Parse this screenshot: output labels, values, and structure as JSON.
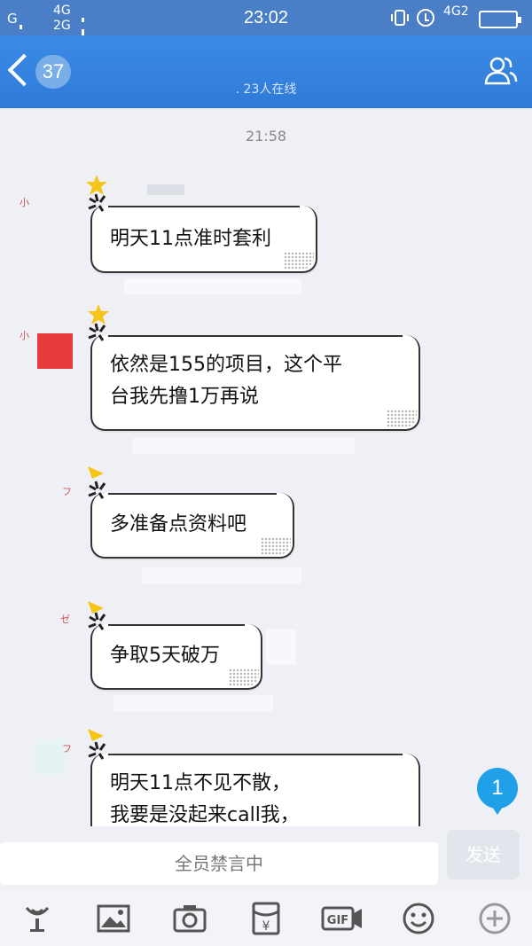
{
  "status_bar": {
    "left_signal_1": "G",
    "net_1": "4G",
    "net_2": "2G",
    "time": "23:02",
    "right_net": "4G2"
  },
  "header": {
    "back_count": "37",
    "subtitle": ". 23人在线"
  },
  "chat": {
    "timestamp": "21:58",
    "messages": [
      {
        "name_tag": "小",
        "lines": [
          "明天11点准时套利"
        ]
      },
      {
        "name_tag": "小",
        "lines": [
          "依然是155的项目，这个平",
          "台我先撸1万再说"
        ]
      },
      {
        "name_tag": "フ",
        "lines": [
          "多准备点资料吧"
        ]
      },
      {
        "name_tag": "ゼ",
        "lines": [
          "争取5天破万"
        ]
      },
      {
        "name_tag": "フ",
        "lines": [
          "明天11点不见不散，",
          "我要是没起来call我，"
        ]
      }
    ],
    "unread_count": "1"
  },
  "input": {
    "muted_text": "全员禁言中",
    "send_label": "发送"
  },
  "toolbar": {
    "icons": [
      "microphone-icon",
      "image-icon",
      "camera-icon",
      "red-packet-icon",
      "gif-icon",
      "emoji-icon",
      "plus-icon"
    ]
  }
}
